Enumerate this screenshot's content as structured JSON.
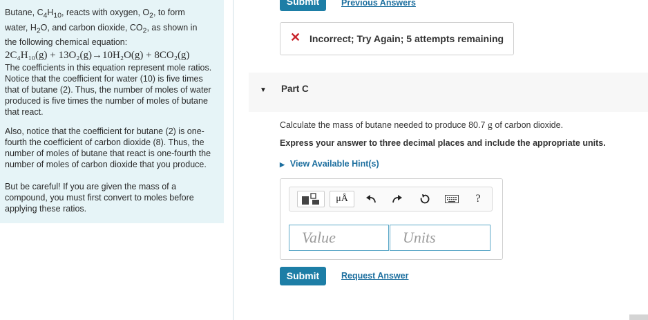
{
  "intro": {
    "p1_a": "Butane, C",
    "p1_sub1": "4",
    "p1_b": "H",
    "p1_sub2": "10",
    "p1_c": ", reacts with oxygen, O",
    "p1_sub3": "2",
    "p1_d": ", to form",
    "p1_line2_a": "water, H",
    "p1_line2_sub": "2",
    "p1_line2_b": "O, and carbon dioxide, CO",
    "p1_line2_sub2": "2",
    "p1_line2_c": ", as shown in",
    "p1_line3": "the following chemical equation:",
    "equation": "2C₄H₁₀(g) + 13O₂(g)→10H₂O(g) + 8CO₂(g)",
    "p2": "The coefficients in this equation represent mole ratios. Notice that the coefficient for water (10) is five times that of butane (2). Thus, the number of moles of water produced is five times the number of moles of butane that react.",
    "p3": "Also, notice that the coefficient for butane (2) is one-fourth the coefficient of carbon dioxide (8). Thus, the number of moles of butane that react is one-fourth the number of moles of carbon dioxide that you produce.",
    "p4": "But be careful! If you are given the mass of a compound, you must first convert to moles before applying these ratios."
  },
  "top": {
    "submit_label": "Submit",
    "previous_answers_label": "Previous Answers"
  },
  "feedback": {
    "icon": "x-icon",
    "text": "Incorrect; Try Again; 5 attempts remaining",
    "color": "#c8242b"
  },
  "part": {
    "label": "Part C"
  },
  "question": {
    "text_a": "Calculate the mass of butane needed to produce 80.7 ",
    "text_g": "g",
    "text_b": " of carbon dioxide.",
    "instruction": "Express your answer to three decimal places and include the appropriate units.",
    "hint_label": "View Available Hint(s)"
  },
  "toolbar": {
    "units_icon": "μÅ",
    "help": "?"
  },
  "answer": {
    "value_placeholder": "Value",
    "units_placeholder": "Units"
  },
  "bottom": {
    "submit_label": "Submit",
    "request_answer_label": "Request Answer"
  },
  "colors": {
    "accent": "#1d7ea6",
    "panel_bg": "#e6f4f7"
  }
}
